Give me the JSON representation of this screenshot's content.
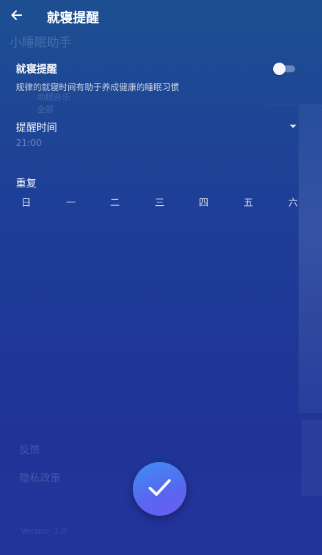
{
  "header": {
    "title": "就寝提醒",
    "back_icon": "arrow-left-icon"
  },
  "background": {
    "app_title": "小睡眠助手",
    "item_sub_1": "助眠音乐",
    "item_sub_2": "全部",
    "feedback": "反馈",
    "privacy": "隐私政策",
    "version": "Version 1.0"
  },
  "reminder": {
    "title": "就寝提醒",
    "description": "规律的就寝时间有助于养成健康的睡眠习惯",
    "enabled": false
  },
  "time": {
    "label": "提醒时间",
    "value": "21:00",
    "dropdown_icon": "caret-down-icon"
  },
  "repeat": {
    "label": "重复",
    "days": [
      "日",
      "一",
      "二",
      "三",
      "四",
      "五",
      "六"
    ]
  },
  "confirm": {
    "icon": "check-icon"
  },
  "colors": {
    "accent_start": "#3e8ef2",
    "accent_end": "#6b5cf0",
    "background_top": "#1d4f92",
    "background_bottom": "#22339a"
  }
}
